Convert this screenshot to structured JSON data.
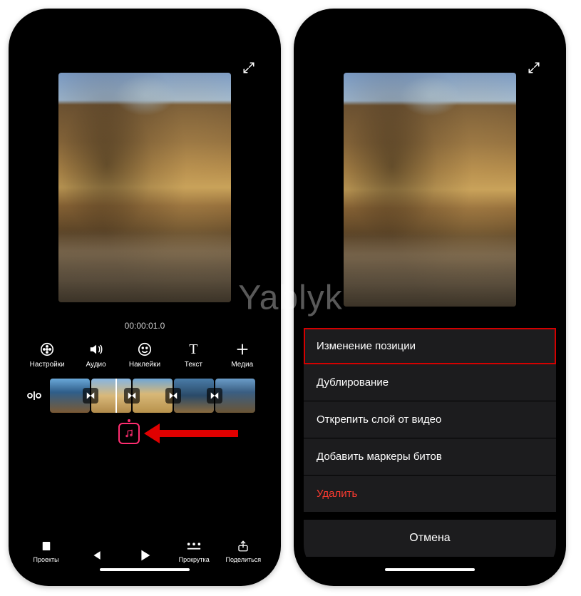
{
  "watermark": "Yablyk",
  "left": {
    "timecode": "00:00:01.0",
    "tools": {
      "settings": "Настройки",
      "audio": "Аудио",
      "stickers": "Наклейки",
      "text": "Текст",
      "text_glyph": "T",
      "media": "Медиа"
    },
    "bottom": {
      "projects": "Проекты",
      "scroll": "Прокрутка",
      "share": "Поделиться"
    }
  },
  "right": {
    "menu": {
      "reposition": "Изменение позиции",
      "duplicate": "Дублирование",
      "detach": "Открепить слой от видео",
      "beat_markers": "Добавить маркеры битов",
      "delete": "Удалить",
      "cancel": "Отмена"
    }
  }
}
